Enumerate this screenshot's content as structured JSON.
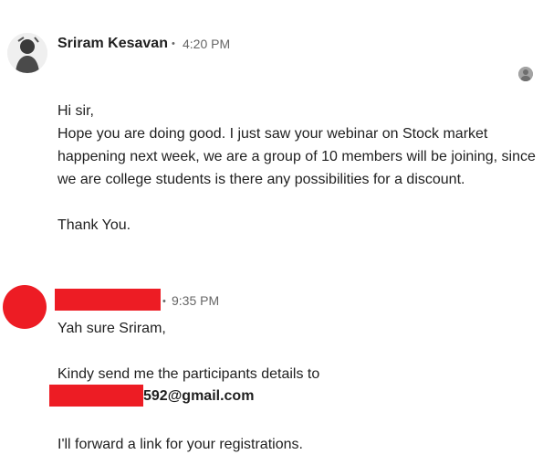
{
  "message1": {
    "sender": "Sriram Kesavan",
    "separator": "•",
    "time": "4:20 PM",
    "avatar_icon": "profile-photo-icon",
    "seen_icon": "seen-avatar-icon",
    "lines": [
      "Hi sir,",
      "Hope you are doing good. I just saw your webinar on Stock market happening next week, we are a group of 10 members will be joining, since we are college students is there any possibilities for a discount.",
      "",
      "Thank You."
    ]
  },
  "message2": {
    "separator": "•",
    "time": "9:35 PM",
    "redaction_color": "#ed1c24",
    "line1": "Yah sure Sriram,",
    "line2": "Kindy send me the participants details to",
    "email_visible": "592@gmail.com",
    "line3": "I'll forward a link for your registrations."
  }
}
